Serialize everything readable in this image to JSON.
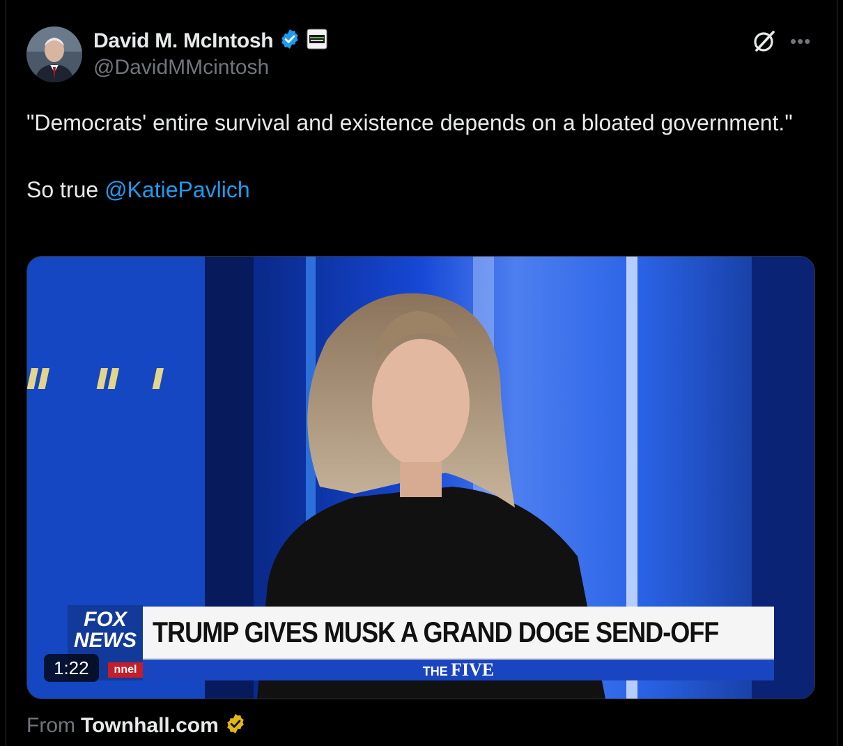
{
  "author": {
    "display_name": "David M. McIntosh",
    "handle": "@DavidMMcintosh",
    "verified_color": "#1d9bf0",
    "affiliation_badge": "club-for-growth-badge"
  },
  "tweet": {
    "text_before": "\"Democrats' entire survival and existence depends on a bloated government.\"\n\nSo true ",
    "mention": "@KatiePavlich"
  },
  "media": {
    "duration": "1:22",
    "chyron_headline": "TRUMP GIVES MUSK A GRAND DOGE SEND-OFF",
    "show_name_the": "THE",
    "show_name_five": "FIVE",
    "network_logo_top": "FOX",
    "network_logo_mid": "NEWS",
    "network_logo_bottom": "nnel"
  },
  "source": {
    "from_label": "From",
    "site": "Townhall.com",
    "badge_color": "#e2b719"
  },
  "colors": {
    "accent": "#1d9bf0",
    "background": "#000000",
    "text": "#e7e9ea",
    "muted": "#71767b"
  }
}
